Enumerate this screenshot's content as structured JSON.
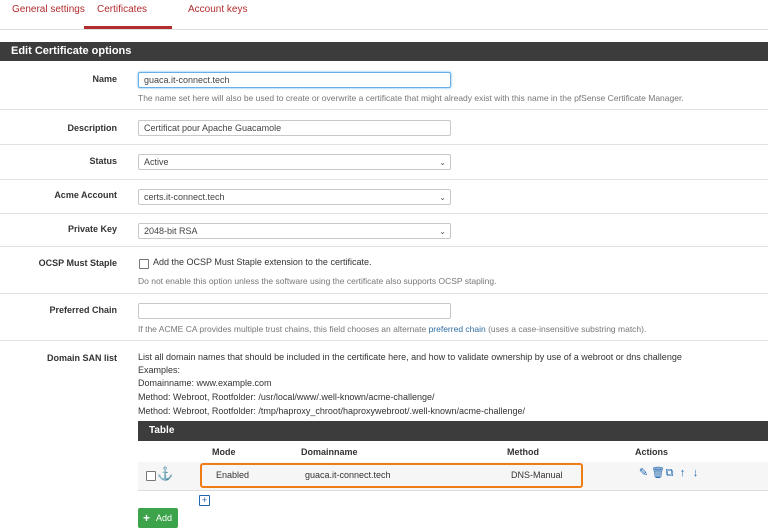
{
  "tabs": [
    {
      "label": "General settings"
    },
    {
      "label": "Certificates"
    },
    {
      "label": "Account keys"
    }
  ],
  "panel": {
    "title": "Edit Certificate options"
  },
  "fields": {
    "name": {
      "label": "Name",
      "value": "guaca.it-connect.tech",
      "help": "The name set here will also be used to create or overwrite a certificate that might already exist with this name in the pfSense Certificate Manager."
    },
    "description": {
      "label": "Description",
      "value": "Certificat pour Apache Guacamole"
    },
    "status": {
      "label": "Status",
      "value": "Active"
    },
    "acme_account": {
      "label": "Acme Account",
      "value": "certs.it-connect.tech"
    },
    "private_key": {
      "label": "Private Key",
      "value": "2048-bit RSA"
    },
    "ocsp": {
      "label": "OCSP Must Staple",
      "checkbox_label": "Add the OCSP Must Staple extension to the certificate.",
      "help": "Do not enable this option unless the software using the certificate also supports OCSP stapling."
    },
    "preferred_chain": {
      "label": "Preferred Chain",
      "value": "",
      "help_before": "If the ACME CA provides multiple trust chains, this field chooses an alternate ",
      "help_link": "preferred chain",
      "help_after": " (uses a case-insensitive substring match)."
    },
    "domain_san": {
      "label": "Domain SAN list",
      "lines": [
        "List all domain names that should be included in the certificate here, and how to validate ownership by use of a webroot or dns challenge",
        "Examples:",
        "Domainname: www.example.com",
        "Method: Webroot, Rootfolder: /usr/local/www/.well-known/acme-challenge/",
        "Method: Webroot, Rootfolder: /tmp/haproxy_chroot/haproxywebroot/.well-known/acme-challenge/"
      ]
    }
  },
  "table": {
    "title": "Table",
    "headers": {
      "mode": "Mode",
      "domainname": "Domainname",
      "method": "Method",
      "actions": "Actions"
    },
    "rows": [
      {
        "mode": "Enabled",
        "domainname": "guaca.it-connect.tech",
        "method": "DNS-Manual"
      }
    ]
  },
  "add_button": {
    "label": "Add"
  },
  "icons": [
    "anchor-icon",
    "pencil-icon",
    "trash-icon",
    "copy-icon",
    "arrow-up-icon",
    "arrow-down-icon",
    "plus-icon"
  ],
  "colors": {
    "accent": "#b32d2e",
    "header": "#3c3c3c",
    "highlight": "#ef7d16",
    "add_button": "#3da34b",
    "link": "#2d6ca2"
  }
}
